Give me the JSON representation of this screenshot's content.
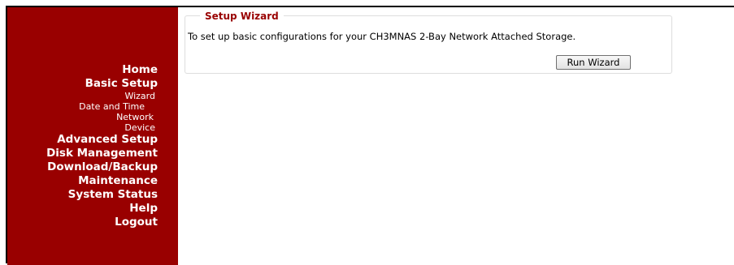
{
  "sidebar": {
    "items": [
      {
        "label": "Home"
      },
      {
        "label": "Basic Setup"
      },
      {
        "label": "Wizard"
      },
      {
        "label": "Date and Time"
      },
      {
        "label": "Network"
      },
      {
        "label": "Device"
      },
      {
        "label": "Advanced Setup"
      },
      {
        "label": "Disk Management"
      },
      {
        "label": "Download/Backup"
      },
      {
        "label": "Maintenance"
      },
      {
        "label": "System Status"
      },
      {
        "label": "Help"
      },
      {
        "label": "Logout"
      }
    ]
  },
  "wizard": {
    "legend": "Setup Wizard",
    "description": "To set up basic configurations for your CH3MNAS 2-Bay Network Attached Storage.",
    "button_label": "Run Wizard"
  },
  "colors": {
    "sidebar_bg": "#990000",
    "legend_text": "#990000"
  }
}
